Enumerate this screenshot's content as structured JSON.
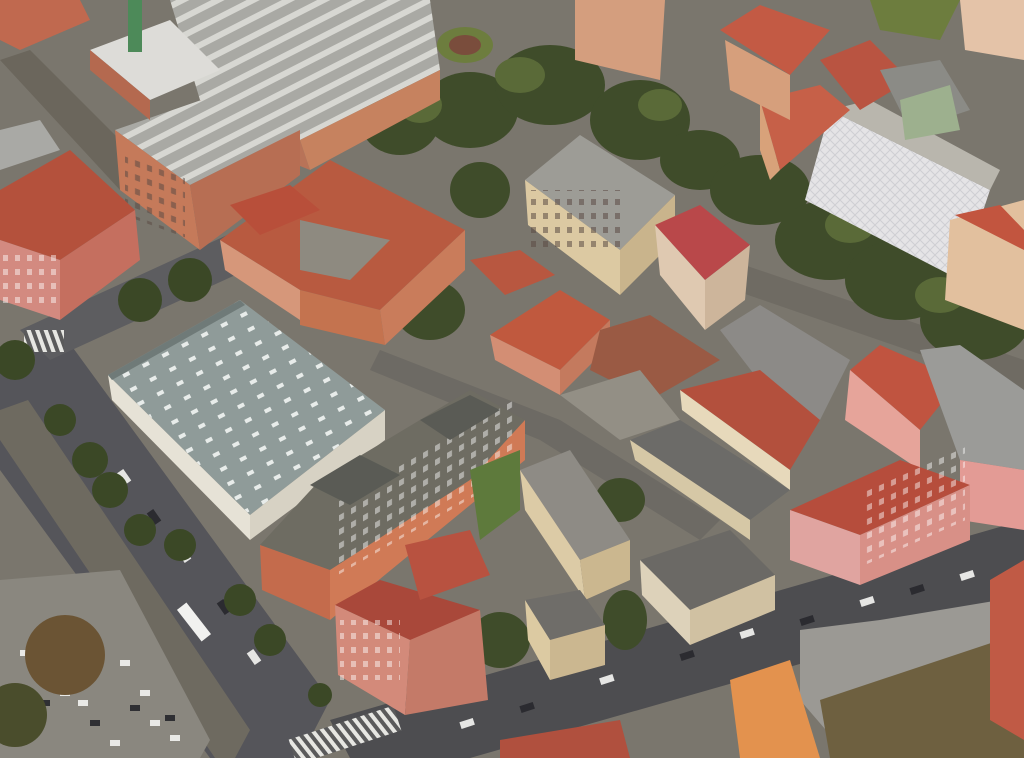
{
  "view": {
    "kind": "aerial-3d-city-view",
    "labels_visible": false
  },
  "palette": {
    "terracotta_roof": "#b9553f",
    "brick_facade": "#c9785a",
    "pink_facade": "#d98c84",
    "cream_facade": "#d9c9a8",
    "flat_grey_roof": "#9a9a96",
    "warehouse_roof": "#8e9a98",
    "asphalt": "#4e4e4f",
    "sidewalk": "#8d8a84",
    "tree_dark": "#3d4a2a",
    "tree_light": "#5a6a38",
    "crosswalk": "#e6e6e2",
    "grass": "#6d7d3e"
  }
}
